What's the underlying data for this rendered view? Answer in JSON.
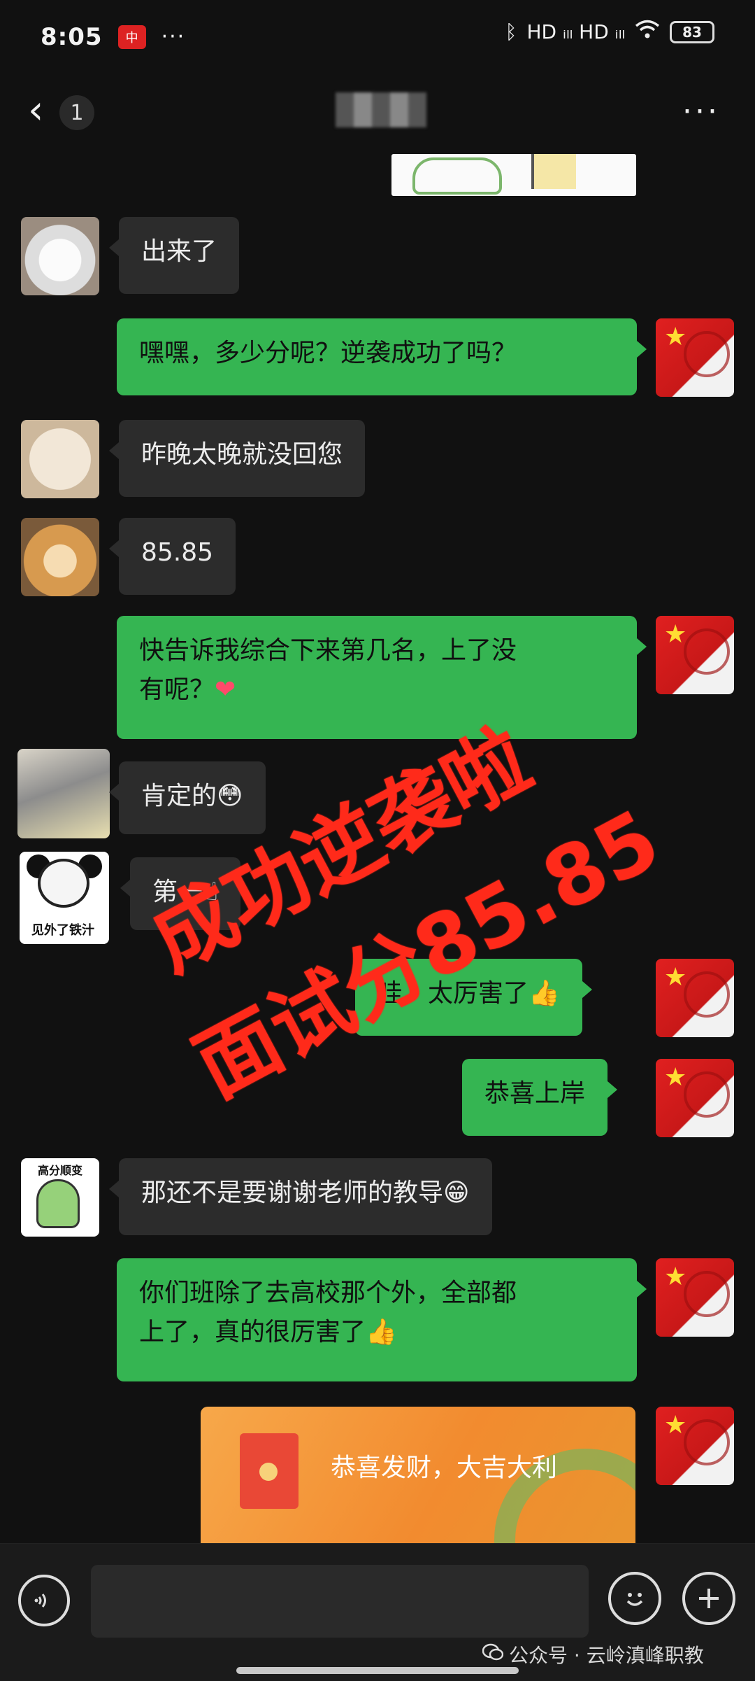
{
  "status_bar": {
    "time": "8:05",
    "app_badge": "中",
    "dots": "···",
    "network": "HD ᵢₗₗ HD ᵢₗₗ",
    "wifi_icon": "wifi-icon",
    "battery": "83"
  },
  "nav": {
    "back_glyph": "‹",
    "unread_count": "1",
    "more_glyph": "···"
  },
  "messages": [
    {
      "side": "left",
      "avatar": "cat-white",
      "text": "出来了"
    },
    {
      "side": "right",
      "text": "嘿嘿，多少分呢？逆袭成功了吗？"
    },
    {
      "side": "left",
      "avatar": "cat-beige",
      "text": "昨晚太晚就没回您"
    },
    {
      "side": "left",
      "avatar": "shiba",
      "text": "85.85"
    },
    {
      "side": "right",
      "text": "快告诉我综合下来第几名，上了没\n有呢？",
      "emoji": "❤"
    },
    {
      "side": "left",
      "avatar": "sock-cat",
      "text": "肯定的",
      "emoji": "😳"
    },
    {
      "side": "left",
      "avatar": "panda-meme",
      "text": "第一",
      "emoji": "☝"
    },
    {
      "side": "right",
      "text": "哇，太厉害了",
      "emoji": "👍"
    },
    {
      "side": "right",
      "text": "恭喜上岸"
    },
    {
      "side": "left",
      "avatar": "dino-sticker",
      "text": "那还不是要谢谢老师的教导",
      "emoji": "😁"
    },
    {
      "side": "right",
      "text": "你们班除了去高校那个外，全部都\n上了，真的很厉害了",
      "emoji": "👍"
    }
  ],
  "avatars": {
    "panda_caption": "见外了铁汁",
    "dino_caption": "高分顺变"
  },
  "red_packet": {
    "title": "恭喜发财，大吉大利"
  },
  "overlay": {
    "line1": "成功逆袭啦",
    "line2": "面试分85.85"
  },
  "input_bar": {
    "input_value": "",
    "voice_icon": "voice-icon",
    "emoji_icon": "emoji-icon",
    "plus_icon": "plus-icon"
  },
  "watermark": {
    "text": "公众号 · 云岭滇峰职教"
  }
}
